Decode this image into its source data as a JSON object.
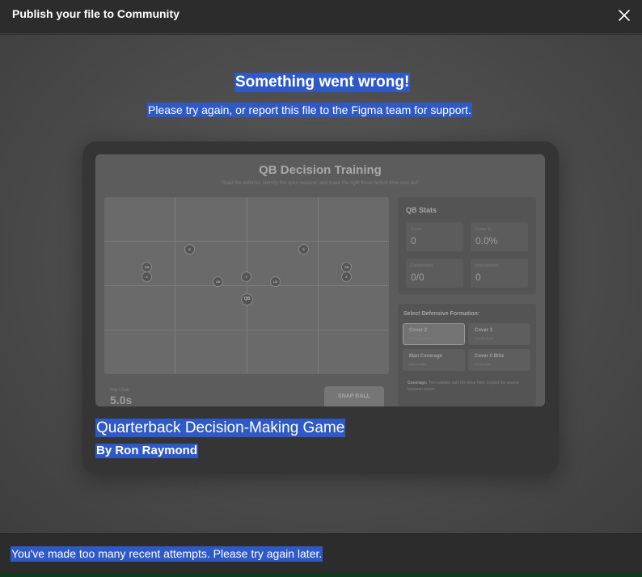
{
  "dialog": {
    "title": "Publish your file to Community",
    "close_icon": "close-icon"
  },
  "error": {
    "title": "Something went wrong!",
    "message": "Please try again, or report this file to the Figma team for support."
  },
  "file": {
    "name": "Quarterback Decision-Making Game",
    "author": "By Ron Raymond"
  },
  "thumbnail": {
    "title": "QB Decision Training",
    "subtitle": "Read the defense, identify the open receiver, and make the right throw before time runs out!",
    "players": [
      "S",
      "S",
      "CB",
      "X",
      "LB",
      "Y",
      "LB",
      "CB",
      "Z",
      "QB"
    ],
    "play_clock_label": "Play Clock",
    "play_clock_value": "5.0s",
    "snap_button": "SNAP BALL",
    "stats": {
      "title": "QB Stats",
      "items": [
        {
          "label": "Score",
          "value": "0"
        },
        {
          "label": "Comp %",
          "value": "0.0%"
        },
        {
          "label": "Completions",
          "value": "0/0"
        },
        {
          "label": "Interceptions",
          "value": "0"
        }
      ]
    },
    "formation": {
      "title": "Select Defensive Formation:",
      "options": [
        {
          "name": "Cover 2",
          "sub": "2 Deep Safeties"
        },
        {
          "name": "Cover 3",
          "sub": "3 Deep Zone"
        },
        {
          "name": "Man Coverage",
          "sub": "Man-to-Man"
        },
        {
          "name": "Cover 0 Blitz",
          "sub": "All-Out Blitz"
        }
      ],
      "desc_label": "Coverage:",
      "desc_text": "Two safeties split the deep field. Exploit the seams between zones."
    }
  },
  "footer": {
    "message": "You've made too many recent attempts. Please try again later."
  }
}
